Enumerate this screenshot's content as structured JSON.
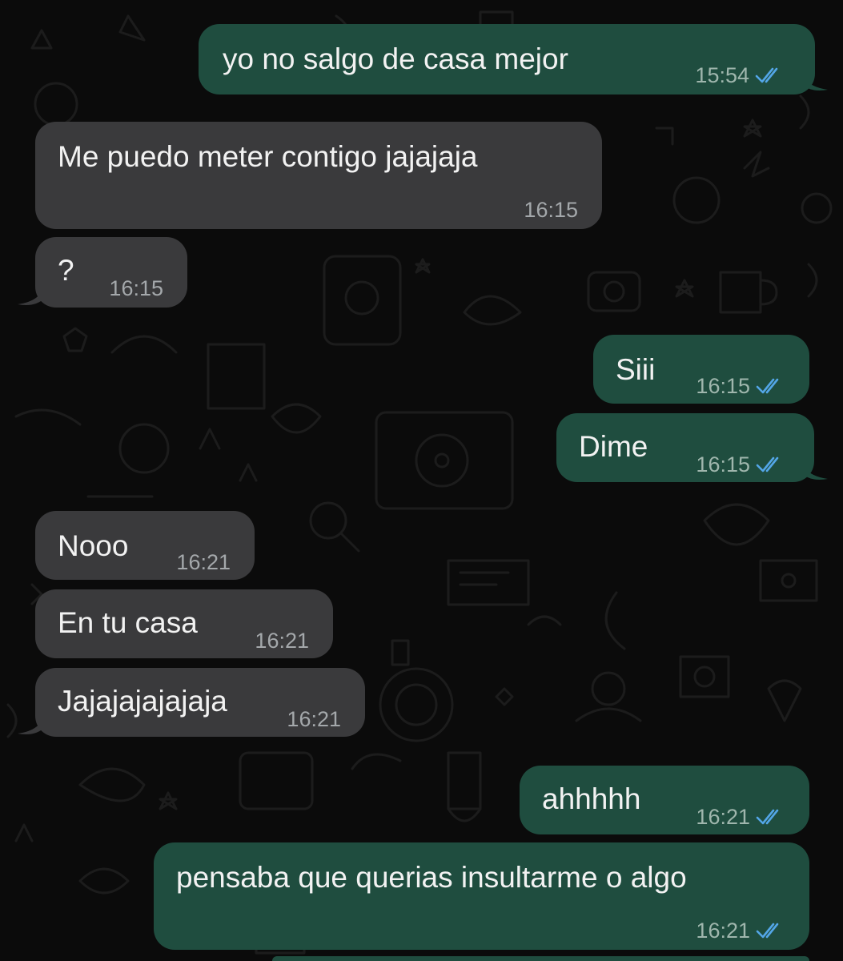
{
  "theme": {
    "incoming_bubble": "#3a3a3c",
    "outgoing_bubble": "#1f4d3f",
    "read_ticks": "#53a6e7",
    "background": "#0b0b0b"
  },
  "messages": [
    {
      "direction": "out",
      "text": "yo no salgo de casa mejor",
      "time": "15:54",
      "status": "double-check-read-icon"
    },
    {
      "direction": "in",
      "text": "Me puedo meter contigo jajajaja",
      "time": "16:15"
    },
    {
      "direction": "in",
      "text": "?",
      "time": "16:15"
    },
    {
      "direction": "out",
      "text": "Siii",
      "time": "16:15",
      "status": "double-check-read-icon"
    },
    {
      "direction": "out",
      "text": "Dime",
      "time": "16:15",
      "status": "double-check-read-icon"
    },
    {
      "direction": "in",
      "text": "Nooo",
      "time": "16:21"
    },
    {
      "direction": "in",
      "text": "En tu casa",
      "time": "16:21"
    },
    {
      "direction": "in",
      "text": "Jajajajajajaja",
      "time": "16:21"
    },
    {
      "direction": "out",
      "text": "ahhhhh",
      "time": "16:21",
      "status": "double-check-read-icon"
    },
    {
      "direction": "out",
      "text": "pensaba que querias insultarme o algo",
      "time": "16:21",
      "status": "double-check-read-icon"
    }
  ]
}
